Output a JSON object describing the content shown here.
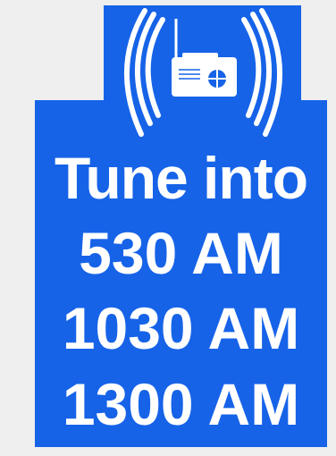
{
  "sign": {
    "background_color": "#1663e8",
    "text_color": "#ffffff",
    "icon": "radio-broadcast-icon",
    "lines": [
      "Tune into",
      "530 AM",
      "1030 AM",
      "1300 AM"
    ]
  }
}
